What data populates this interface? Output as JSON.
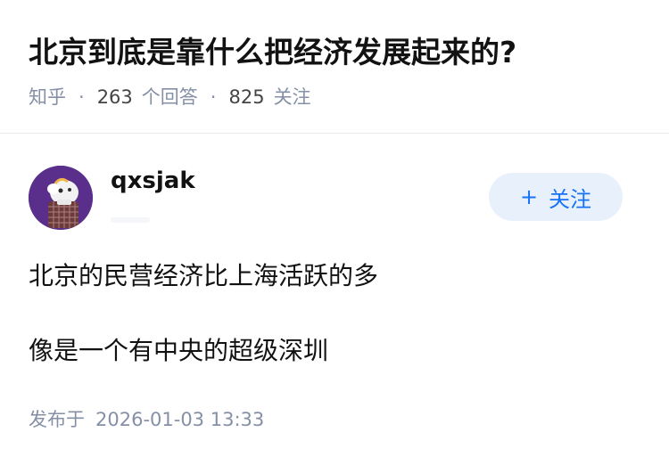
{
  "question": {
    "title": "北京到底是靠什么把经济发展起来的?",
    "source": "知乎",
    "separator": "·",
    "answers_count": "263",
    "answers_label": "个回答",
    "followers_count": "825",
    "followers_label": "关注"
  },
  "answer": {
    "author": {
      "name": "qxsjak",
      "avatar_icon": "avatar-illustration-icon",
      "avatar_bg": "#5a2f8c"
    },
    "follow_button": {
      "plus": "+",
      "label": "关注",
      "bg": "#e8f1fb",
      "color": "#1772f6"
    },
    "paragraphs": [
      "北京的民营经济比上海活跃的多",
      "像是一个有中央的超级深圳"
    ],
    "published": {
      "label": "发布于",
      "datetime": "2026-01-03 13:33"
    }
  }
}
